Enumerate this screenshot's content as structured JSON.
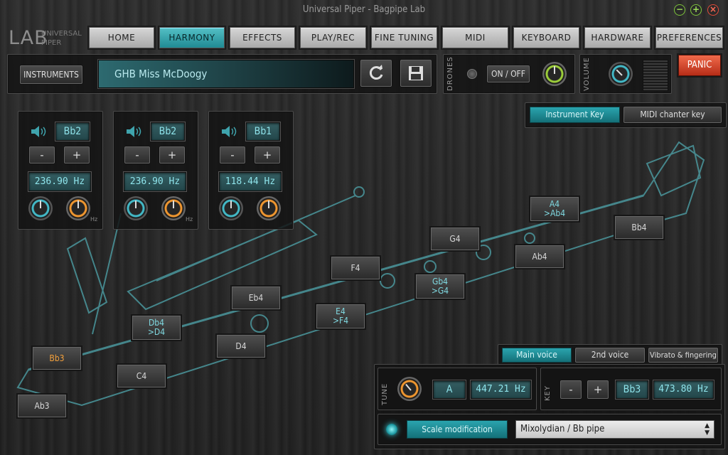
{
  "window": {
    "title": "Universal Piper - Bagpipe Lab"
  },
  "logo": {
    "main": "LAB",
    "line1": "UNIVERSAL",
    "line2": "PIPER"
  },
  "tabs": [
    {
      "label": "HOME"
    },
    {
      "label": "HARMONY"
    },
    {
      "label": "EFFECTS"
    },
    {
      "label": "PLAY/REC"
    },
    {
      "label": "FINE TUNING"
    },
    {
      "label": "MIDI"
    },
    {
      "label": "KEYBOARD"
    },
    {
      "label": "HARDWARE"
    },
    {
      "label": "PREFERENCES"
    }
  ],
  "instrument": {
    "button_label": "INSTRUMENTS",
    "name": "GHB Miss McDoogy"
  },
  "drones": {
    "label": "DRONES",
    "toggle_label": "ON / OFF"
  },
  "volume": {
    "label": "VOLUME"
  },
  "panic_label": "PANIC",
  "key_mode": {
    "instrument_key": "Instrument Key",
    "midi_key": "MIDI chanter key"
  },
  "drone_channels": [
    {
      "note": "Bb2",
      "minus": "-",
      "plus": "+",
      "freq": "236.90 Hz",
      "unit": "Hz"
    },
    {
      "note": "Bb2",
      "minus": "-",
      "plus": "+",
      "freq": "236.90 Hz",
      "unit": "Hz"
    },
    {
      "note": "Bb1",
      "minus": "-",
      "plus": "+",
      "freq": "118.44 Hz",
      "unit": "Hz"
    }
  ],
  "chanter_notes": [
    {
      "label": "Ab3"
    },
    {
      "label": "Bb3"
    },
    {
      "label": "C4"
    },
    {
      "label": "Db4",
      "label2": ">D4"
    },
    {
      "label": "D4"
    },
    {
      "label": "Eb4"
    },
    {
      "label": "E4",
      "label2": ">F4"
    },
    {
      "label": "F4"
    },
    {
      "label": "Gb4",
      "label2": ">G4"
    },
    {
      "label": "G4"
    },
    {
      "label": "Ab4"
    },
    {
      "label": "A4",
      "label2": ">Ab4"
    },
    {
      "label": "Bb4"
    }
  ],
  "voice_tabs": [
    {
      "label": "Main voice"
    },
    {
      "label": "2nd voice"
    },
    {
      "label": "Vibrato & fingering"
    }
  ],
  "tune": {
    "label": "TUNE",
    "note": "A",
    "freq": "447.21 Hz"
  },
  "key": {
    "label": "KEY",
    "minus": "-",
    "plus": "+",
    "note": "Bb3",
    "freq": "473.80 Hz"
  },
  "scale": {
    "button_label": "Scale modification",
    "selected": "Mixolydian / Bb pipe"
  },
  "colors": {
    "accent": "#2a9aa5",
    "orange": "#f09730",
    "panic": "#d8442c"
  }
}
